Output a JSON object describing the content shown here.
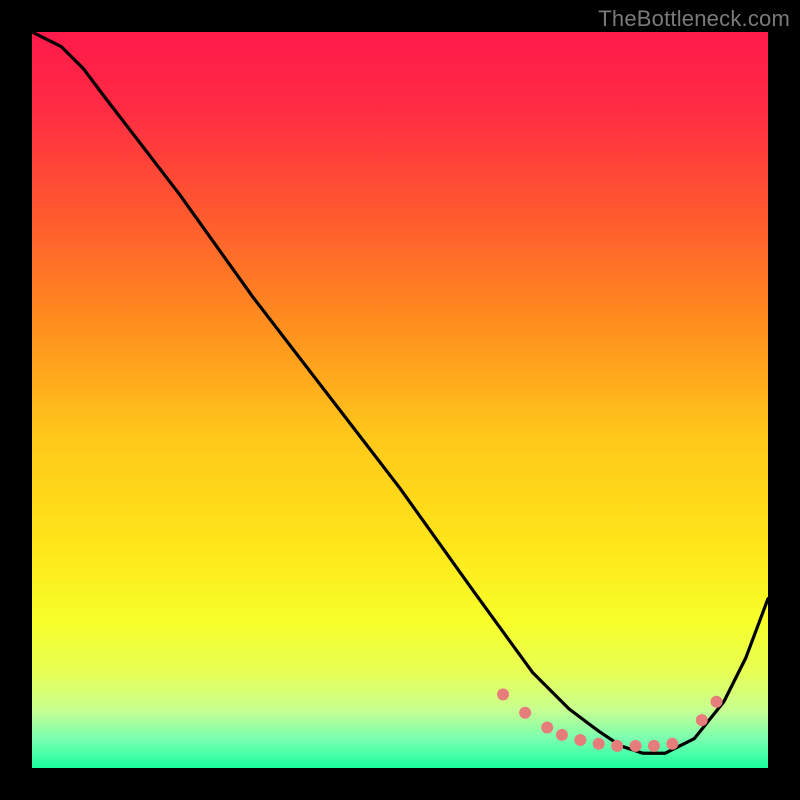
{
  "watermark": "TheBottleneck.com",
  "chart_data": {
    "type": "line",
    "title": "",
    "xlabel": "",
    "ylabel": "",
    "xlim": [
      0,
      100
    ],
    "ylim": [
      0,
      100
    ],
    "grid": false,
    "legend": false,
    "gradient_stops": [
      {
        "offset": 0.0,
        "color": "#ff1a4b"
      },
      {
        "offset": 0.1,
        "color": "#ff2a44"
      },
      {
        "offset": 0.25,
        "color": "#ff5a2e"
      },
      {
        "offset": 0.4,
        "color": "#ff8f1e"
      },
      {
        "offset": 0.55,
        "color": "#ffc81a"
      },
      {
        "offset": 0.7,
        "color": "#ffe61a"
      },
      {
        "offset": 0.8,
        "color": "#f7ff2a"
      },
      {
        "offset": 0.87,
        "color": "#e7ff55"
      },
      {
        "offset": 0.92,
        "color": "#c9ff90"
      },
      {
        "offset": 0.96,
        "color": "#7affb0"
      },
      {
        "offset": 1.0,
        "color": "#1aff9f"
      }
    ],
    "series": [
      {
        "name": "curve",
        "color": "#000000",
        "x": [
          0,
          4,
          7,
          10,
          20,
          30,
          40,
          50,
          60,
          68,
          73,
          77,
          80,
          83,
          86,
          90,
          94,
          97,
          100
        ],
        "y": [
          100,
          98,
          95,
          91,
          78,
          64,
          51,
          38,
          24,
          13,
          8,
          5,
          3,
          2,
          2,
          4,
          9,
          15,
          23
        ]
      }
    ],
    "markers": {
      "name": "dots",
      "color": "#e77d7a",
      "radius": 6,
      "x": [
        64,
        67,
        70,
        72,
        74.5,
        77,
        79.5,
        82,
        84.5,
        87,
        91,
        93
      ],
      "y": [
        10,
        7.5,
        5.5,
        4.5,
        3.8,
        3.3,
        3.0,
        3.0,
        3.0,
        3.3,
        6.5,
        9.0
      ]
    }
  }
}
